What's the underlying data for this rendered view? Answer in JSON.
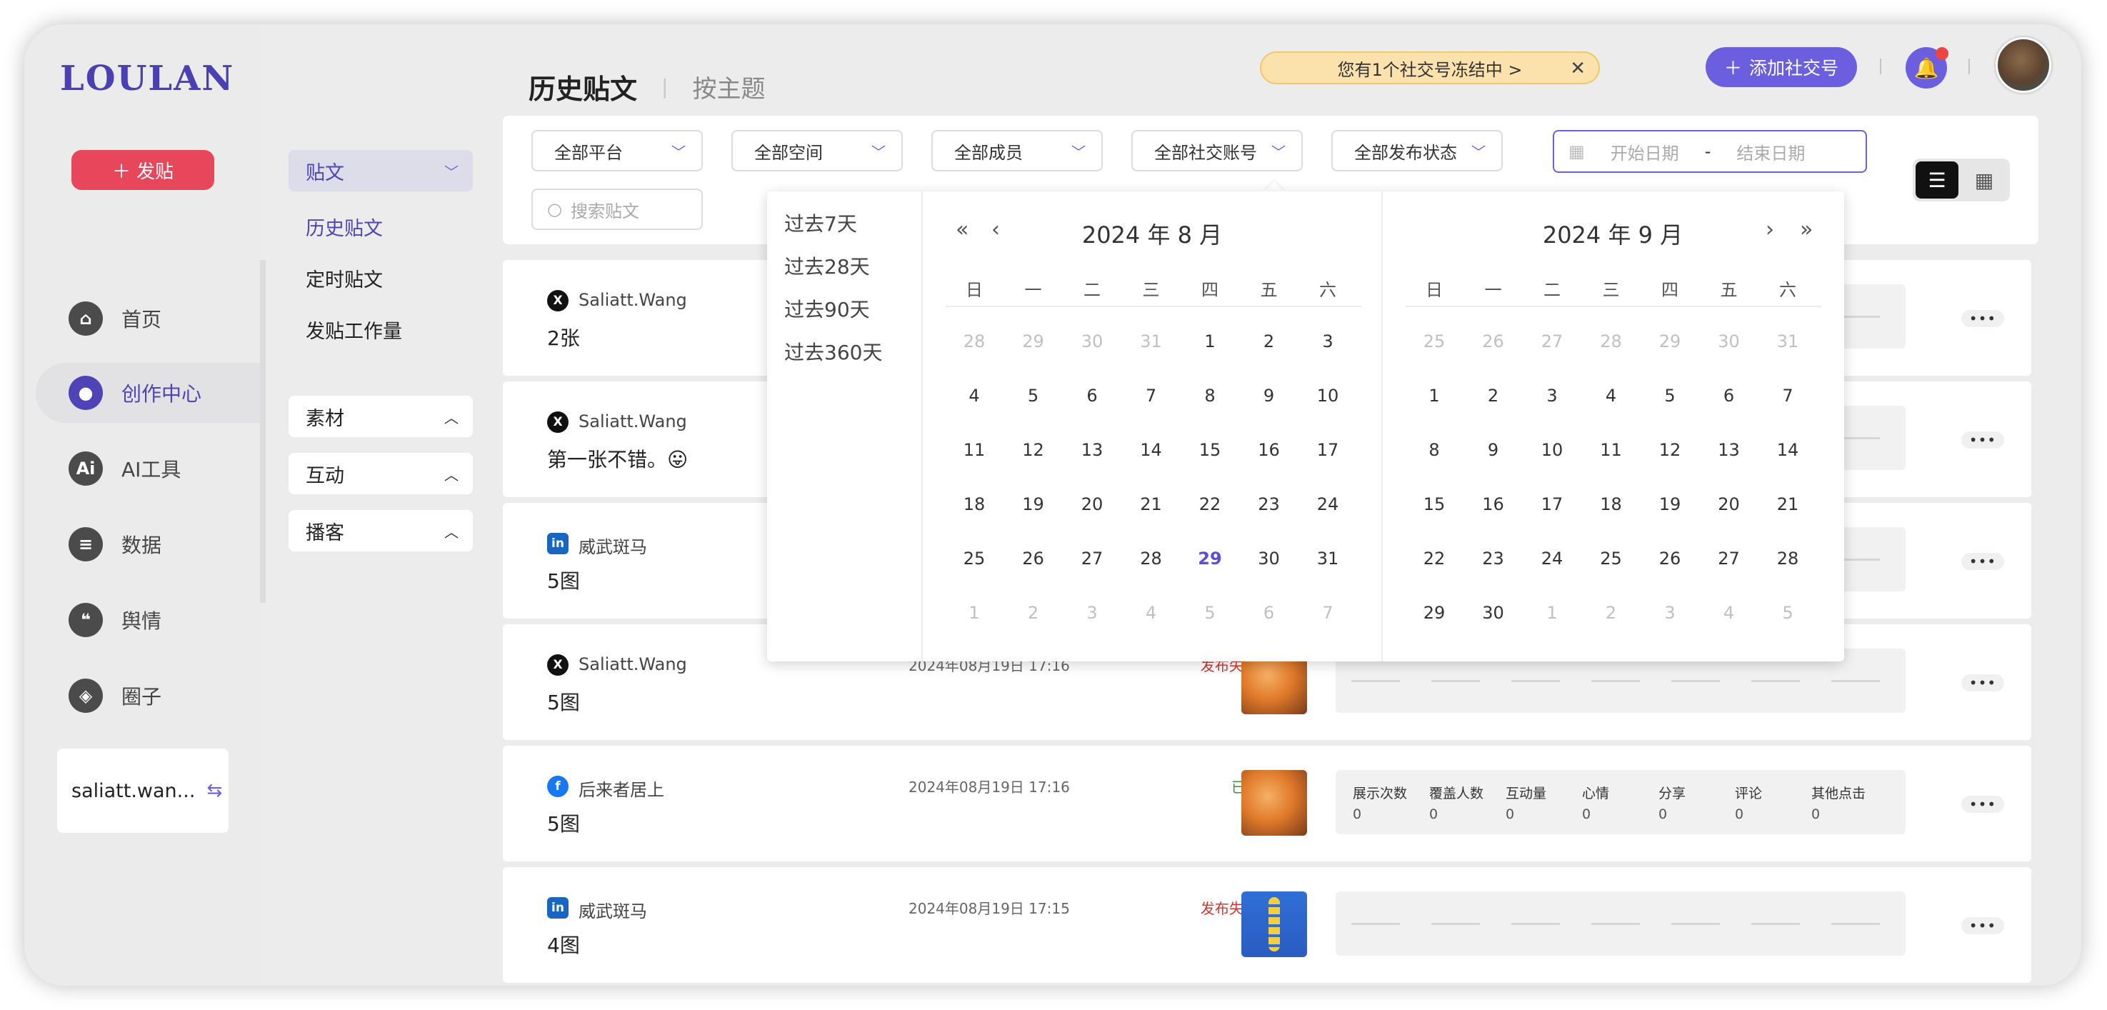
{
  "app": {
    "logo": "LOULAN"
  },
  "left_nav": {
    "post_button": "发贴",
    "items": [
      {
        "label": "首页",
        "icon": "home-icon",
        "glyph": "⌂"
      },
      {
        "label": "创作中心",
        "icon": "palette-icon",
        "glyph": "●"
      },
      {
        "label": "AI工具",
        "icon": "ai-icon",
        "glyph": "Ai"
      },
      {
        "label": "数据",
        "icon": "database-icon",
        "glyph": "≡"
      },
      {
        "label": "舆情",
        "icon": "quote-icon",
        "glyph": "❝"
      },
      {
        "label": "圈子",
        "icon": "compass-icon",
        "glyph": "◈"
      }
    ],
    "account": "saliatt.wan..."
  },
  "sub_nav": {
    "posts_group": "贴文",
    "links": [
      "历史贴文",
      "定时贴文",
      "发贴工作量"
    ],
    "groups": [
      "素材",
      "互动",
      "播客"
    ]
  },
  "header": {
    "tab_active": "历史贴文",
    "tab_other": "按主题",
    "notice": "您有1个社交号冻结中 >",
    "add_button": "添加社交号"
  },
  "filters": {
    "selects": [
      "全部平台",
      "全部空间",
      "全部成员",
      "全部社交账号",
      "全部发布状态"
    ],
    "date_start_placeholder": "开始日期",
    "date_end_placeholder": "结束日期",
    "date_dash": "-",
    "search_placeholder": "搜索贴文"
  },
  "posts": [
    {
      "platform": "X",
      "account": "Saliatt.Wang",
      "text": "2张",
      "time": "",
      "status": "",
      "status_type": ""
    },
    {
      "platform": "X",
      "account": "Saliatt.Wang",
      "text": "第一张不错。😛",
      "time": "",
      "status": "",
      "status_type": ""
    },
    {
      "platform": "in",
      "account": "威武斑马",
      "text": "5图",
      "time": "",
      "status": "",
      "status_type": ""
    },
    {
      "platform": "X",
      "account": "Saliatt.Wang",
      "text": "5图",
      "time": "2024年08月19日 17:16",
      "status": "发布失败 >",
      "status_type": "fail"
    },
    {
      "platform": "f",
      "account": "后来者居上",
      "text": "5图",
      "time": "2024年08月19日 17:16",
      "status": "已发布",
      "status_type": "ok",
      "metrics": [
        {
          "label": "展示次数",
          "value": "0"
        },
        {
          "label": "覆盖人数",
          "value": "0"
        },
        {
          "label": "互动量",
          "value": "0"
        },
        {
          "label": "心情",
          "value": "0"
        },
        {
          "label": "分享",
          "value": "0"
        },
        {
          "label": "评论",
          "value": "0"
        },
        {
          "label": "其他点击",
          "value": "0"
        }
      ]
    },
    {
      "platform": "in",
      "account": "威武斑马",
      "text": "4图",
      "time": "2024年08月19日 17:15",
      "status": "发布失败 >",
      "status_type": "fail"
    }
  ],
  "more_label": "•••",
  "date_picker": {
    "presets": [
      "过去7天",
      "过去28天",
      "过去90天",
      "过去360天"
    ],
    "weekdays": [
      "日",
      "一",
      "二",
      "三",
      "四",
      "五",
      "六"
    ],
    "left": {
      "title": "2024 年 8 月",
      "weeks": [
        [
          [
            "28",
            1
          ],
          [
            "29",
            1
          ],
          [
            "30",
            1
          ],
          [
            "31",
            1
          ],
          [
            "1",
            0
          ],
          [
            "2",
            0
          ],
          [
            "3",
            0
          ]
        ],
        [
          [
            "4",
            0
          ],
          [
            "5",
            0
          ],
          [
            "6",
            0
          ],
          [
            "7",
            0
          ],
          [
            "8",
            0
          ],
          [
            "9",
            0
          ],
          [
            "10",
            0
          ]
        ],
        [
          [
            "11",
            0
          ],
          [
            "12",
            0
          ],
          [
            "13",
            0
          ],
          [
            "14",
            0
          ],
          [
            "15",
            0
          ],
          [
            "16",
            0
          ],
          [
            "17",
            0
          ]
        ],
        [
          [
            "18",
            0
          ],
          [
            "19",
            0
          ],
          [
            "20",
            0
          ],
          [
            "21",
            0
          ],
          [
            "22",
            0
          ],
          [
            "23",
            0
          ],
          [
            "24",
            0
          ]
        ],
        [
          [
            "25",
            0
          ],
          [
            "26",
            0
          ],
          [
            "27",
            0
          ],
          [
            "28",
            0
          ],
          [
            "29",
            2
          ],
          [
            "30",
            0
          ],
          [
            "31",
            0
          ]
        ],
        [
          [
            "1",
            1
          ],
          [
            "2",
            1
          ],
          [
            "3",
            1
          ],
          [
            "4",
            1
          ],
          [
            "5",
            1
          ],
          [
            "6",
            1
          ],
          [
            "7",
            1
          ]
        ]
      ]
    },
    "right": {
      "title": "2024 年 9 月",
      "weeks": [
        [
          [
            "25",
            1
          ],
          [
            "26",
            1
          ],
          [
            "27",
            1
          ],
          [
            "28",
            1
          ],
          [
            "29",
            1
          ],
          [
            "30",
            1
          ],
          [
            "31",
            1
          ]
        ],
        [
          [
            "1",
            0
          ],
          [
            "2",
            0
          ],
          [
            "3",
            0
          ],
          [
            "4",
            0
          ],
          [
            "5",
            0
          ],
          [
            "6",
            0
          ],
          [
            "7",
            0
          ]
        ],
        [
          [
            "8",
            0
          ],
          [
            "9",
            0
          ],
          [
            "10",
            0
          ],
          [
            "11",
            0
          ],
          [
            "12",
            0
          ],
          [
            "13",
            0
          ],
          [
            "14",
            0
          ]
        ],
        [
          [
            "15",
            0
          ],
          [
            "16",
            0
          ],
          [
            "17",
            0
          ],
          [
            "18",
            0
          ],
          [
            "19",
            0
          ],
          [
            "20",
            0
          ],
          [
            "21",
            0
          ]
        ],
        [
          [
            "22",
            0
          ],
          [
            "23",
            0
          ],
          [
            "24",
            0
          ],
          [
            "25",
            0
          ],
          [
            "26",
            0
          ],
          [
            "27",
            0
          ],
          [
            "28",
            0
          ]
        ],
        [
          [
            "29",
            0
          ],
          [
            "30",
            0
          ],
          [
            "1",
            1
          ],
          [
            "2",
            1
          ],
          [
            "3",
            1
          ],
          [
            "4",
            1
          ],
          [
            "5",
            1
          ]
        ]
      ]
    }
  }
}
